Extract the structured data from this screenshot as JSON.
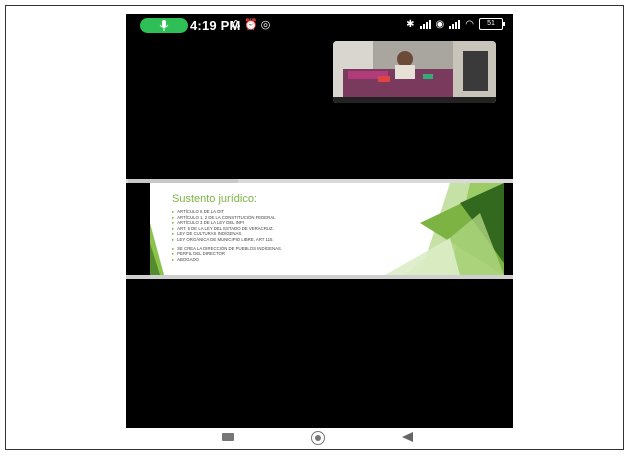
{
  "status_bar": {
    "time": "4:19 PM",
    "battery_level": "51"
  },
  "slide": {
    "title": "Sustento jurídico:",
    "bullets": [
      "ARTÍCULO 6 DE LA OIT",
      "ARTÍCULO 1, 2 DE LA CONSTITUCIÓN FEDERAL",
      "ARTÍCULO 3 DE LA LEY DEL INPI",
      "ART. 5 DE LA LEY DEL ESTADO DE VERACRUZ.",
      "LEY DE CULTURAS INDÍGENAS.",
      "LEY ORGÁNICA DE MUNICIPIO LIBRE, ART 115."
    ],
    "bullets_2": [
      "SE CREA LA DIRECCIÓN DE PUEBLOS INDÍGENAS.",
      "PERFIL DEL DIRECTOR",
      "ABOGADO"
    ],
    "accent_color": "#7cb342"
  },
  "colors": {
    "mic_active": "#2fbf57",
    "screen_bg": "#000000"
  }
}
